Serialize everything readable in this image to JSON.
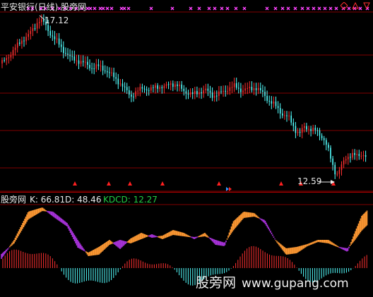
{
  "header": {
    "title": "平安银行(日线) 股旁网"
  },
  "price_panel": {
    "high_label": "17.12",
    "low_label": "12.59"
  },
  "indicator": {
    "title": "股旁网",
    "k_text": "K: 66.81",
    "d_text": "D: 48.46",
    "kdcd_text": "KDCD: 12.27"
  },
  "watermark": {
    "cn": "股旁网",
    "url": "www.gupang.com"
  },
  "controls": [
    "diamond-icon",
    "up-triangle-icon",
    "down-triangle-icon"
  ],
  "colors": {
    "up": "#ff3030",
    "down": "#54ffff",
    "k_line": "#ff9933",
    "d_line": "#aa33dd",
    "marker_x": "#ff44ff",
    "signal": "#ff2020",
    "grid": "#800000",
    "kdcd": "#22cc44"
  }
}
